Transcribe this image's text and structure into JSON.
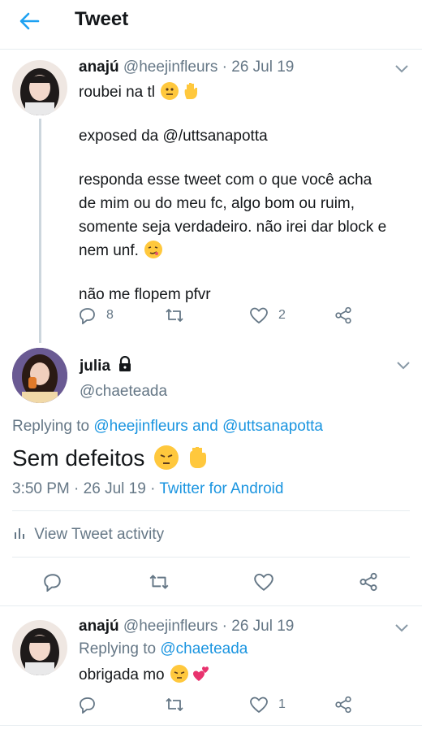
{
  "header": {
    "title": "Tweet"
  },
  "tweet1": {
    "name": "anajú",
    "handle": "@heejinfleurs",
    "sep": "·",
    "date": "26 Jul 19",
    "lines": [
      "roubei na tl",
      "exposed da @/uttsanapotta",
      "responda esse tweet com o que você acha",
      "de mim ou do meu fc, algo bom ou ruim,",
      "somente seja verdadeiro. não irei dar block e",
      "nem unf.",
      "não me flopem pfvr"
    ],
    "replies": "8",
    "likes": "2"
  },
  "main": {
    "name": "julia",
    "handle": "@chaeteada",
    "replying_prefix": "Replying to",
    "replying_user1": "@heejinfleurs",
    "replying_and": "and",
    "replying_user2": "@uttsanapotta",
    "text": "Sem defeitos",
    "time": "3:50 PM",
    "sep": "·",
    "date": "26 Jul 19",
    "sep2": "·",
    "source": "Twitter for Android",
    "activity": "View Tweet activity"
  },
  "tweet3": {
    "name": "anajú",
    "handle": "@heejinfleurs",
    "sep": "·",
    "date": "26 Jul 19",
    "replying_prefix": "Replying to",
    "replying_user": "@chaeteada",
    "text": "obrigada mo",
    "likes": "1"
  },
  "colors": {
    "link": "#1b95e0",
    "muted": "#657786",
    "divider": "#e6ecf0"
  }
}
